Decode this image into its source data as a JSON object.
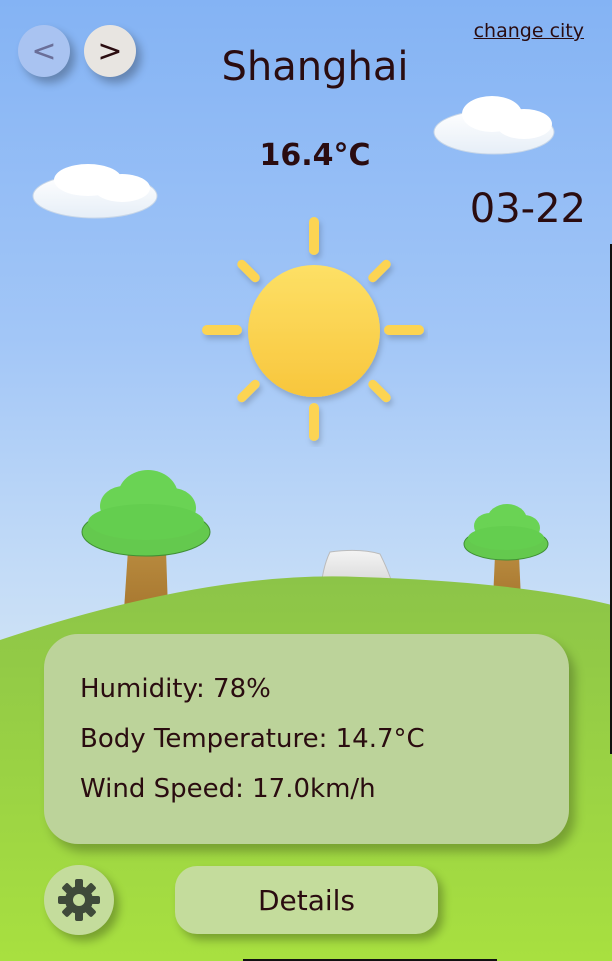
{
  "nav": {
    "prev_label": "<",
    "next_label": ">",
    "change_city_label": "change city"
  },
  "weather": {
    "city": "Shanghai",
    "temperature": "16.4°C",
    "date": "03-22",
    "condition_icon": "sun-icon"
  },
  "info": {
    "humidity": "Humidity: 78%",
    "body_temperature": "Body Temperature: 14.7°C",
    "wind_speed": "Wind Speed: 17.0km/h"
  },
  "footer": {
    "settings_icon": "gear-icon",
    "details_label": "Details"
  },
  "colors": {
    "sky_top": "#84b3f4",
    "sun": "#fcd452",
    "grass": "#8ec63f",
    "card": "#bcd39a",
    "button": "#c4dc9c",
    "text": "#2a0c10"
  }
}
